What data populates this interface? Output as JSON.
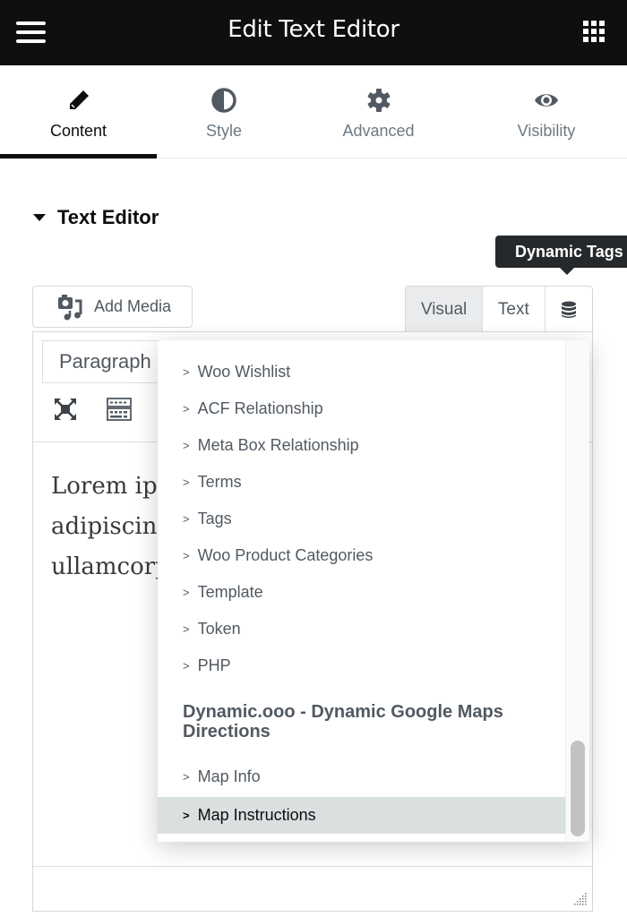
{
  "header": {
    "title": "Edit Text Editor",
    "menu_icon": "hamburger-icon",
    "apps_icon": "grid-icon"
  },
  "tabs": [
    {
      "label": "Content",
      "icon": "pencil-icon",
      "active": true
    },
    {
      "label": "Style",
      "icon": "contrast-icon",
      "active": false
    },
    {
      "label": "Advanced",
      "icon": "gear-icon",
      "active": false
    },
    {
      "label": "Visibility",
      "icon": "eye-icon",
      "active": false
    }
  ],
  "section": {
    "title": "Text Editor"
  },
  "tooltip": {
    "text": "Dynamic Tags"
  },
  "media": {
    "add_media_label": "Add Media"
  },
  "mode_tabs": {
    "visual": "Visual",
    "text": "Text",
    "dynamic_icon": "database-icon"
  },
  "editor": {
    "format_value": "Paragraph",
    "content_lines": [
      "Lorem ipsum dolor sit amet, consectetur",
      "adipiscing elit. Ut elit tellus, luctus nec",
      "ullamcorper mattis, pulvinar dapibus leo."
    ]
  },
  "dropdown": {
    "items": [
      {
        "label": "Woo Wishlist"
      },
      {
        "label": "ACF Relationship"
      },
      {
        "label": "Meta Box Relationship"
      },
      {
        "label": "Terms"
      },
      {
        "label": "Tags"
      },
      {
        "label": "Woo Product Categories"
      },
      {
        "label": "Template"
      },
      {
        "label": "Token"
      },
      {
        "label": "PHP"
      }
    ],
    "group_title": "Dynamic.ooo - Dynamic Google Maps Directions",
    "group_items": [
      {
        "label": "Map Info",
        "selected": false
      },
      {
        "label": "Map Instructions",
        "selected": true
      }
    ],
    "chevron": ">"
  },
  "colors": {
    "header_bg": "#0e0f11",
    "tooltip_bg": "#26292c",
    "selected_bg": "#dadfe0",
    "text_muted": "#515962"
  }
}
